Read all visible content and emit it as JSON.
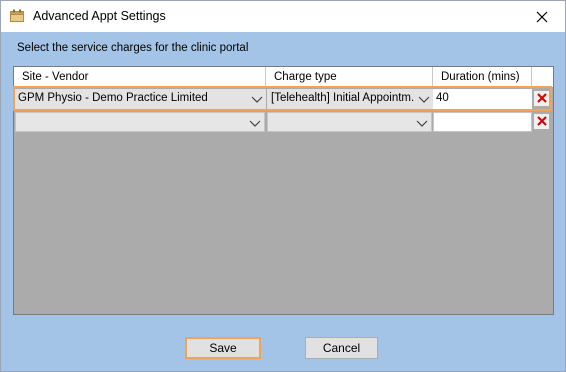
{
  "window": {
    "title": "Advanced Appt Settings",
    "icon": "calendar-app-icon",
    "close_icon": "close-icon"
  },
  "instruction": "Select the service charges for the clinic portal",
  "grid": {
    "columns": [
      "Site - Vendor",
      "Charge type",
      "Duration (mins)"
    ],
    "rows": [
      {
        "site_vendor": "GPM Physio - Demo Practice Limited",
        "charge_type": "[Telehealth] Initial Appointm...",
        "duration": "40",
        "delete_icon": "delete-x-icon"
      },
      {
        "site_vendor": "",
        "charge_type": "",
        "duration": "",
        "delete_icon": "delete-x-icon"
      }
    ]
  },
  "buttons": {
    "save_label": "Save",
    "cancel_label": "Cancel"
  },
  "colors": {
    "dialog_background": "#a3c4e6",
    "grid_background": "#ababab",
    "highlight": "#f0a35a",
    "delete_x": "#d40000"
  }
}
